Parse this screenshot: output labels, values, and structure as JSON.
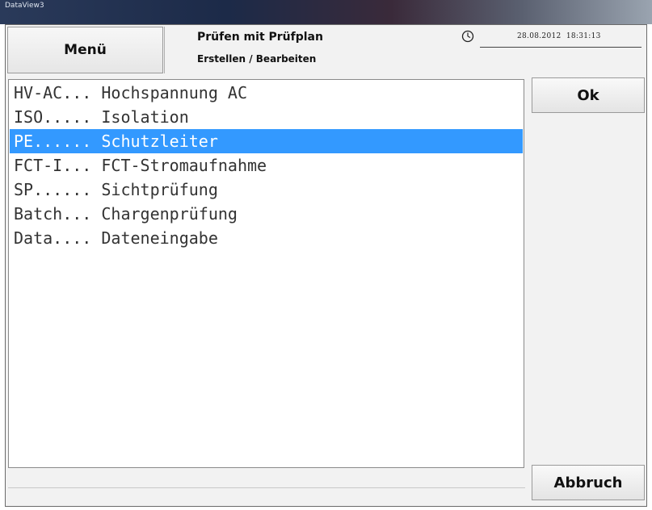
{
  "window": {
    "title": "DataView3"
  },
  "header": {
    "menu_label": "Menü",
    "title": "Prüfen mit Prüfplan",
    "subtitle": "Erstellen / Bearbeiten",
    "date": "28.08.2012",
    "time": "18:31:13",
    "clock_icon": "clock-icon"
  },
  "list": {
    "selected_index": 2,
    "items": [
      {
        "label": "HV-AC... Hochspannung AC"
      },
      {
        "label": "ISO..... Isolation"
      },
      {
        "label": "PE...... Schutzleiter"
      },
      {
        "label": "FCT-I... FCT-Stromaufnahme"
      },
      {
        "label": "SP...... Sichtprüfung"
      },
      {
        "label": "Batch... Chargenprüfung"
      },
      {
        "label": "Data.... Dateneingabe"
      }
    ]
  },
  "buttons": {
    "ok_label": "Ok",
    "cancel_label": "Abbruch"
  },
  "colors": {
    "selection": "#3399ff"
  }
}
